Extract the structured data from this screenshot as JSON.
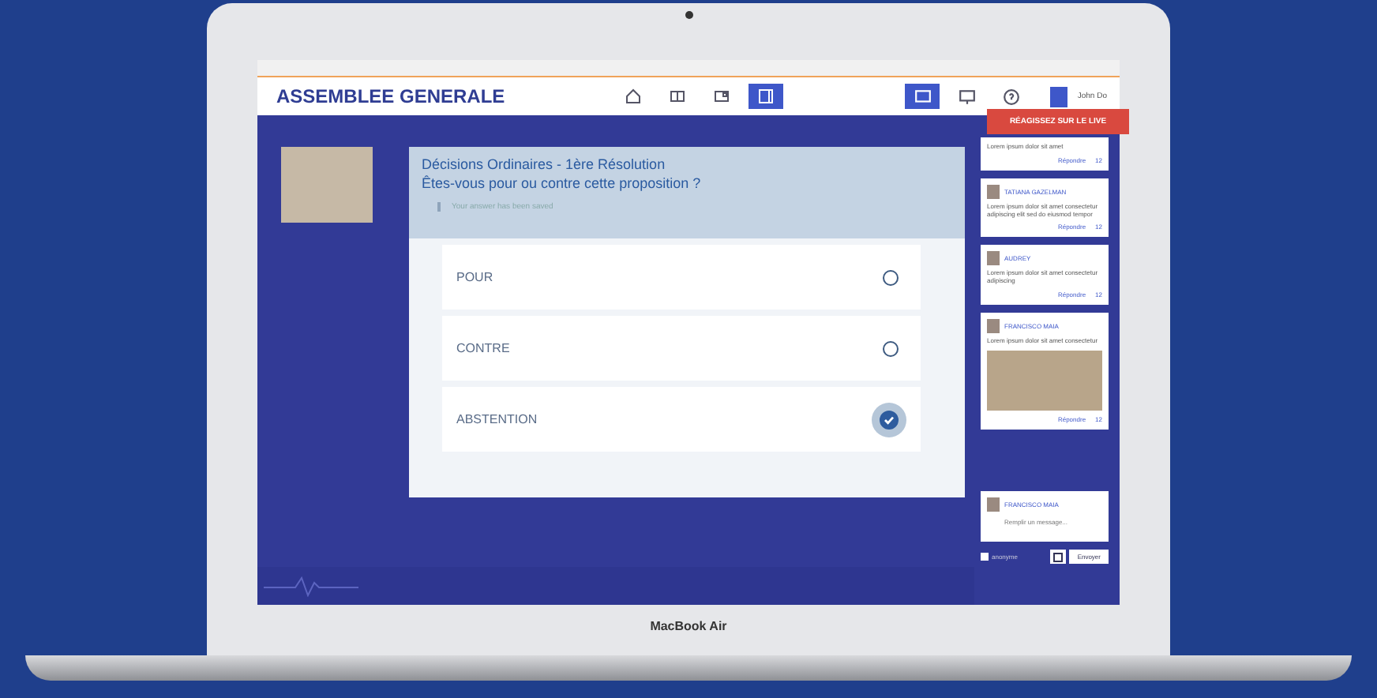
{
  "device": {
    "label": "MacBook Air"
  },
  "header": {
    "title": "ASSEMBLEE GENERALE",
    "user": "John Do",
    "nav": [
      {
        "selected": false
      },
      {
        "selected": false
      },
      {
        "selected": false
      },
      {
        "selected": true
      }
    ],
    "tools": [
      {
        "selected": true
      },
      {
        "selected": false
      },
      {
        "selected": false
      }
    ]
  },
  "live_banner": "RÉAGISSEZ SUR LE LIVE",
  "question": {
    "title": "Décisions Ordinaires - 1ère Résolution",
    "prompt": "Êtes-vous pour ou contre cette proposition ?",
    "notice": "Your answer has been saved",
    "options": [
      {
        "label": "POUR",
        "selected": false
      },
      {
        "label": "CONTRE",
        "selected": false
      },
      {
        "label": "ABSTENTION",
        "selected": true
      }
    ]
  },
  "comments": [
    {
      "body": "Lorem ipsum dolor sit amet",
      "reply": "Répondre",
      "likes": "12",
      "photo": false
    },
    {
      "author": "TATIANA GAZELMAN",
      "body": "Lorem ipsum dolor sit amet consectetur adipiscing elit sed do eiusmod tempor",
      "reply": "Répondre",
      "likes": "12",
      "photo": false
    },
    {
      "author": "AUDREY",
      "body": "Lorem ipsum dolor sit amet consectetur adipiscing",
      "reply": "Répondre",
      "likes": "12",
      "photo": false
    },
    {
      "author": "FRANCISCO MAIA",
      "body": "Lorem ipsum dolor sit amet consectetur",
      "reply": "Répondre",
      "likes": "12",
      "photo": true
    }
  ],
  "composer": {
    "author": "FRANCISCO MAIA",
    "placeholder": "Remplir un message...",
    "anonymous_label": "anonyme",
    "anonymous": false,
    "send": "Envoyer"
  }
}
